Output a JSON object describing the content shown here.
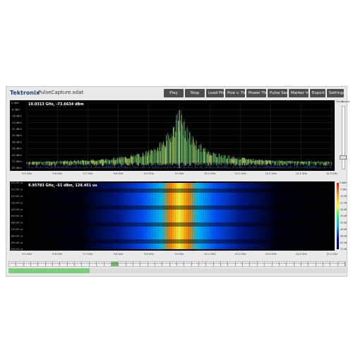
{
  "app": {
    "logo": "Tektronix",
    "file_name": "PulseCapture.xdat"
  },
  "toolbar": [
    {
      "label": "Play"
    },
    {
      "label": "Stop"
    },
    {
      "label": "Load File"
    },
    {
      "label": "Pow v. Time"
    },
    {
      "label": "Power Thresh"
    },
    {
      "label": "Pulse Search"
    },
    {
      "label": "Marker View"
    },
    {
      "label": "Export"
    },
    {
      "label": "Settings"
    }
  ],
  "spectrum": {
    "readout": "10.0313 GHz, -73.6634 dBm",
    "y_ticks": [
      "0 dBm",
      "-8 dBm",
      "-16 dBm",
      "-24 dBm",
      "-32 dBm",
      "-40 dBm",
      "-48 dBm",
      "-56 dBm",
      "-64 dBm",
      "-72 dBm",
      "-80 dBm"
    ],
    "x_ticks": [
      "9.5 GHz",
      "9.6 GHz",
      "9.7 GHz",
      "9.8 GHz",
      "9.9 GHz",
      "10 GHz",
      "10.1 GHz",
      "10.2 GHz",
      "10.3 GHz",
      "10.4 GHz",
      "10.5 GHz"
    ],
    "trace_color": "#c8e878"
  },
  "side_controls": {
    "zoom_label": "Zoom",
    "speed_label": "Speed"
  },
  "waterfall": {
    "readout": "9.95783 GHz, -51 dBm, 128.451 us",
    "y_ticks": [
      "100.00 us",
      "110.00 us",
      "120.00 us",
      "130.00 us",
      "140.00 us",
      "150.00 us",
      "160.00 us",
      "170.00 us",
      "180.00 us",
      "190.00 us",
      "200.00 us"
    ],
    "x_ticks": [
      "9.5 GHz",
      "9.6 GHz",
      "9.7 GHz",
      "9.8 GHz",
      "9.9 GHz",
      "10 GHz",
      "10.1 GHz",
      "10.2 GHz",
      "10.3 GHz",
      "10.4 GHz",
      "10.5 GHz"
    ]
  },
  "colorbar": {
    "labels": [
      "0 dBm",
      "-7 dBm",
      "-14 dBm",
      "-21 dBm",
      "-28 dBm",
      "-35 dBm",
      "-42 dBm",
      "-49 dBm",
      "-56 dBm",
      "-63 dBm",
      "-70 dBm"
    ]
  },
  "timeline": {
    "cell_label": "1.0 ms",
    "count": 46,
    "selected_index": 14
  },
  "progress": {
    "fraction": 0.24
  }
}
